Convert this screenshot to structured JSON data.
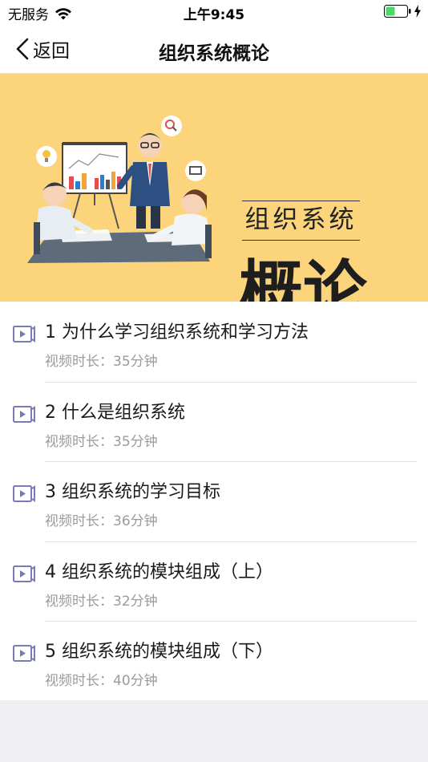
{
  "status_bar": {
    "carrier": "无服务",
    "time": "上午9:45"
  },
  "nav": {
    "back_label": "返回",
    "title": "组织系统概论"
  },
  "banner": {
    "subtitle": "组织系统",
    "main_text": "概论"
  },
  "lessons": [
    {
      "title": "1 为什么学习组织系统和学习方法",
      "duration": "视频时长：35分钟"
    },
    {
      "title": "2 什么是组织系统",
      "duration": "视频时长：35分钟"
    },
    {
      "title": "3 组织系统的学习目标",
      "duration": "视频时长：36分钟"
    },
    {
      "title": "4 组织系统的模块组成（上）",
      "duration": "视频时长：32分钟"
    },
    {
      "title": "5 组织系统的模块组成（下）",
      "duration": "视频时长：40分钟"
    }
  ],
  "colors": {
    "banner_bg": "#fbd47b",
    "icon_accent": "#7b7ab8",
    "battery_green": "#4cd964"
  }
}
